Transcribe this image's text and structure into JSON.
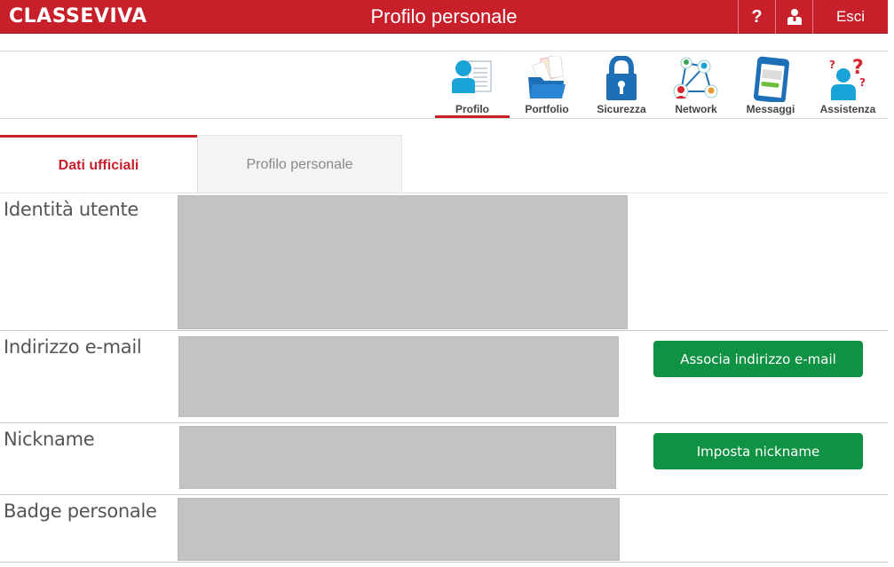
{
  "header": {
    "logo_text": "CLASSEVIVA",
    "title": "Profilo personale",
    "help_label": "?",
    "help_icon": "question-mark-icon",
    "user_icon": "user-icon",
    "logout_label": "Esci"
  },
  "nav": {
    "items": [
      {
        "label": "Profilo",
        "icon": "profile-card-icon",
        "active": true
      },
      {
        "label": "Portfolio",
        "icon": "folder-icon",
        "active": false
      },
      {
        "label": "Sicurezza",
        "icon": "padlock-icon",
        "active": false
      },
      {
        "label": "Network",
        "icon": "network-icon",
        "active": false
      },
      {
        "label": "Messaggi",
        "icon": "phone-message-icon",
        "active": false
      },
      {
        "label": "Assistenza",
        "icon": "help-person-icon",
        "active": false
      }
    ]
  },
  "tabs": [
    {
      "label": "Dati ufficiali",
      "active": true
    },
    {
      "label": "Profilo personale",
      "active": false
    }
  ],
  "rows": [
    {
      "label": "Identità utente",
      "value": "[redacted]"
    },
    {
      "label": "Indirizzo e-mail",
      "value": "[redacted]",
      "button": "Associa indirizzo e-mail"
    },
    {
      "label": "Nickname",
      "value": "[redacted]",
      "button": "Imposta nickname"
    },
    {
      "label": "Badge personale",
      "value": "[redacted]"
    }
  ],
  "colors": {
    "brand_red": "#c8202a",
    "action_green": "#109245",
    "redacted_gray": "#c3c3c3"
  }
}
